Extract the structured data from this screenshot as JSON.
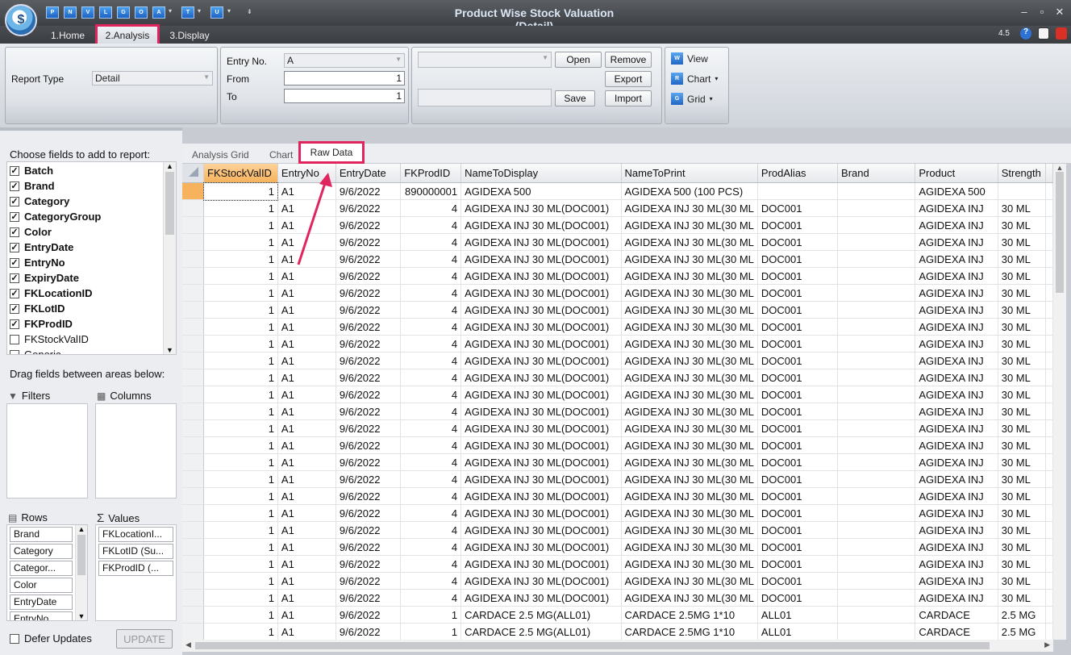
{
  "window": {
    "title": "Product Wise Stock Valuation (Detail)",
    "version": "4.5"
  },
  "qat": [
    "P",
    "N",
    "V",
    "L",
    "G",
    "O",
    "A",
    "T",
    "U"
  ],
  "ribbon_tabs": [
    "1.Home",
    "2.Analysis",
    "3.Display"
  ],
  "report_type": {
    "label": "Report Type",
    "value": "Detail"
  },
  "entry": {
    "entry_no_label": "Entry No.",
    "entry_no_value": "A",
    "from_label": "From",
    "from_value": "1",
    "to_label": "To",
    "to_value": "1"
  },
  "layout_buttons": {
    "open": "Open",
    "remove": "Remove",
    "export": "Export",
    "save": "Save",
    "import": "Import"
  },
  "view_group": {
    "view": "View",
    "chart": "Chart",
    "grid": "Grid"
  },
  "left": {
    "choose_label": "Choose fields to add to report:",
    "fields": [
      {
        "name": "Batch",
        "checked": true
      },
      {
        "name": "Brand",
        "checked": true
      },
      {
        "name": "Category",
        "checked": true
      },
      {
        "name": "CategoryGroup",
        "checked": true
      },
      {
        "name": "Color",
        "checked": true
      },
      {
        "name": "EntryDate",
        "checked": true
      },
      {
        "name": "EntryNo",
        "checked": true
      },
      {
        "name": "ExpiryDate",
        "checked": true
      },
      {
        "name": "FKLocationID",
        "checked": true
      },
      {
        "name": "FKLotID",
        "checked": true
      },
      {
        "name": "FKProdID",
        "checked": true
      },
      {
        "name": "FKStockValID",
        "checked": false
      },
      {
        "name": "Generic",
        "checked": false
      }
    ],
    "drag_label": "Drag fields between areas below:",
    "filters": "Filters",
    "columns": "Columns",
    "rows": "Rows",
    "values": "Values",
    "row_fields": [
      "Brand",
      "Category",
      "Categor...",
      "Color",
      "EntryDate",
      "EntryNo"
    ],
    "value_fields": [
      "FKLocationI...",
      "FKLotID (Su...",
      "FKProdID (..."
    ],
    "defer": "Defer Updates",
    "update": "UPDATE"
  },
  "grid_tabs": [
    "Analysis Grid",
    "Chart",
    "Raw Data"
  ],
  "grid": {
    "columns": [
      "FKStockValID",
      "EntryNo",
      "EntryDate",
      "FKProdID",
      "NameToDisplay",
      "NameToPrint",
      "ProdAlias",
      "Brand",
      "Product",
      "Strength"
    ],
    "rows": [
      [
        "1",
        "A1",
        "9/6/2022",
        "890000001",
        "AGIDEXA 500",
        "AGIDEXA 500 (100 PCS)",
        "",
        "",
        "AGIDEXA 500",
        ""
      ],
      [
        "1",
        "A1",
        "9/6/2022",
        "4",
        "AGIDEXA INJ 30 ML(DOC001)",
        "AGIDEXA INJ 30 ML(30 ML",
        "DOC001",
        "",
        "AGIDEXA INJ",
        "30 ML"
      ],
      [
        "1",
        "A1",
        "9/6/2022",
        "4",
        "AGIDEXA INJ 30 ML(DOC001)",
        "AGIDEXA INJ 30 ML(30 ML",
        "DOC001",
        "",
        "AGIDEXA INJ",
        "30 ML"
      ],
      [
        "1",
        "A1",
        "9/6/2022",
        "4",
        "AGIDEXA INJ 30 ML(DOC001)",
        "AGIDEXA INJ 30 ML(30 ML",
        "DOC001",
        "",
        "AGIDEXA INJ",
        "30 ML"
      ],
      [
        "1",
        "A1",
        "9/6/2022",
        "4",
        "AGIDEXA INJ 30 ML(DOC001)",
        "AGIDEXA INJ 30 ML(30 ML",
        "DOC001",
        "",
        "AGIDEXA INJ",
        "30 ML"
      ],
      [
        "1",
        "A1",
        "9/6/2022",
        "4",
        "AGIDEXA INJ 30 ML(DOC001)",
        "AGIDEXA INJ 30 ML(30 ML",
        "DOC001",
        "",
        "AGIDEXA INJ",
        "30 ML"
      ],
      [
        "1",
        "A1",
        "9/6/2022",
        "4",
        "AGIDEXA INJ 30 ML(DOC001)",
        "AGIDEXA INJ 30 ML(30 ML",
        "DOC001",
        "",
        "AGIDEXA INJ",
        "30 ML"
      ],
      [
        "1",
        "A1",
        "9/6/2022",
        "4",
        "AGIDEXA INJ 30 ML(DOC001)",
        "AGIDEXA INJ 30 ML(30 ML",
        "DOC001",
        "",
        "AGIDEXA INJ",
        "30 ML"
      ],
      [
        "1",
        "A1",
        "9/6/2022",
        "4",
        "AGIDEXA INJ 30 ML(DOC001)",
        "AGIDEXA INJ 30 ML(30 ML",
        "DOC001",
        "",
        "AGIDEXA INJ",
        "30 ML"
      ],
      [
        "1",
        "A1",
        "9/6/2022",
        "4",
        "AGIDEXA INJ 30 ML(DOC001)",
        "AGIDEXA INJ 30 ML(30 ML",
        "DOC001",
        "",
        "AGIDEXA INJ",
        "30 ML"
      ],
      [
        "1",
        "A1",
        "9/6/2022",
        "4",
        "AGIDEXA INJ 30 ML(DOC001)",
        "AGIDEXA INJ 30 ML(30 ML",
        "DOC001",
        "",
        "AGIDEXA INJ",
        "30 ML"
      ],
      [
        "1",
        "A1",
        "9/6/2022",
        "4",
        "AGIDEXA INJ 30 ML(DOC001)",
        "AGIDEXA INJ 30 ML(30 ML",
        "DOC001",
        "",
        "AGIDEXA INJ",
        "30 ML"
      ],
      [
        "1",
        "A1",
        "9/6/2022",
        "4",
        "AGIDEXA INJ 30 ML(DOC001)",
        "AGIDEXA INJ 30 ML(30 ML",
        "DOC001",
        "",
        "AGIDEXA INJ",
        "30 ML"
      ],
      [
        "1",
        "A1",
        "9/6/2022",
        "4",
        "AGIDEXA INJ 30 ML(DOC001)",
        "AGIDEXA INJ 30 ML(30 ML",
        "DOC001",
        "",
        "AGIDEXA INJ",
        "30 ML"
      ],
      [
        "1",
        "A1",
        "9/6/2022",
        "4",
        "AGIDEXA INJ 30 ML(DOC001)",
        "AGIDEXA INJ 30 ML(30 ML",
        "DOC001",
        "",
        "AGIDEXA INJ",
        "30 ML"
      ],
      [
        "1",
        "A1",
        "9/6/2022",
        "4",
        "AGIDEXA INJ 30 ML(DOC001)",
        "AGIDEXA INJ 30 ML(30 ML",
        "DOC001",
        "",
        "AGIDEXA INJ",
        "30 ML"
      ],
      [
        "1",
        "A1",
        "9/6/2022",
        "4",
        "AGIDEXA INJ 30 ML(DOC001)",
        "AGIDEXA INJ 30 ML(30 ML",
        "DOC001",
        "",
        "AGIDEXA INJ",
        "30 ML"
      ],
      [
        "1",
        "A1",
        "9/6/2022",
        "4",
        "AGIDEXA INJ 30 ML(DOC001)",
        "AGIDEXA INJ 30 ML(30 ML",
        "DOC001",
        "",
        "AGIDEXA INJ",
        "30 ML"
      ],
      [
        "1",
        "A1",
        "9/6/2022",
        "4",
        "AGIDEXA INJ 30 ML(DOC001)",
        "AGIDEXA INJ 30 ML(30 ML",
        "DOC001",
        "",
        "AGIDEXA INJ",
        "30 ML"
      ],
      [
        "1",
        "A1",
        "9/6/2022",
        "4",
        "AGIDEXA INJ 30 ML(DOC001)",
        "AGIDEXA INJ 30 ML(30 ML",
        "DOC001",
        "",
        "AGIDEXA INJ",
        "30 ML"
      ],
      [
        "1",
        "A1",
        "9/6/2022",
        "4",
        "AGIDEXA INJ 30 ML(DOC001)",
        "AGIDEXA INJ 30 ML(30 ML",
        "DOC001",
        "",
        "AGIDEXA INJ",
        "30 ML"
      ],
      [
        "1",
        "A1",
        "9/6/2022",
        "4",
        "AGIDEXA INJ 30 ML(DOC001)",
        "AGIDEXA INJ 30 ML(30 ML",
        "DOC001",
        "",
        "AGIDEXA INJ",
        "30 ML"
      ],
      [
        "1",
        "A1",
        "9/6/2022",
        "4",
        "AGIDEXA INJ 30 ML(DOC001)",
        "AGIDEXA INJ 30 ML(30 ML",
        "DOC001",
        "",
        "AGIDEXA INJ",
        "30 ML"
      ],
      [
        "1",
        "A1",
        "9/6/2022",
        "4",
        "AGIDEXA INJ 30 ML(DOC001)",
        "AGIDEXA INJ 30 ML(30 ML",
        "DOC001",
        "",
        "AGIDEXA INJ",
        "30 ML"
      ],
      [
        "1",
        "A1",
        "9/6/2022",
        "4",
        "AGIDEXA INJ 30 ML(DOC001)",
        "AGIDEXA INJ 30 ML(30 ML",
        "DOC001",
        "",
        "AGIDEXA INJ",
        "30 ML"
      ],
      [
        "1",
        "A1",
        "9/6/2022",
        "1",
        "CARDACE 2.5 MG(ALL01)",
        "CARDACE 2.5MG 1*10",
        "ALL01",
        "",
        "CARDACE",
        "2.5 MG"
      ],
      [
        "1",
        "A1",
        "9/6/2022",
        "1",
        "CARDACE 2.5 MG(ALL01)",
        "CARDACE 2.5MG 1*10",
        "ALL01",
        "",
        "CARDACE",
        "2.5 MG"
      ]
    ]
  }
}
